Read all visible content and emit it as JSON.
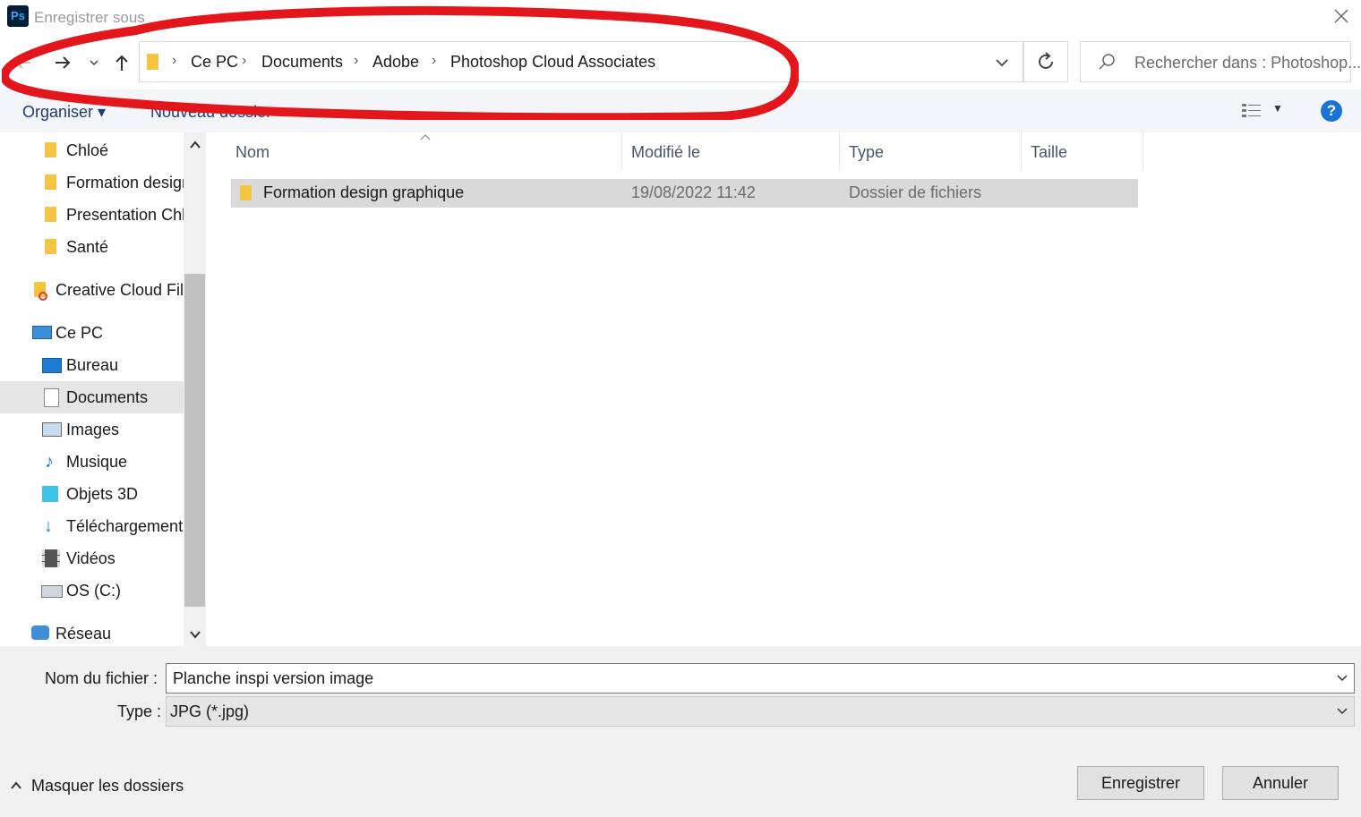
{
  "window": {
    "title": "Enregistrer sous",
    "app_icon_text": "Ps"
  },
  "address": {
    "crumbs": [
      "Ce PC",
      "Documents",
      "Adobe",
      "Photoshop Cloud Associates"
    ]
  },
  "search": {
    "placeholder": "Rechercher dans : Photoshop..."
  },
  "toolbar": {
    "organise_label": "Organiser",
    "new_folder_label": "Nouveau dossier"
  },
  "navpane": {
    "items": [
      {
        "label": "Chloé",
        "icon": "folder-icon"
      },
      {
        "label": "Formation design graphique",
        "icon": "folder-icon"
      },
      {
        "label": "Presentation Chloé",
        "icon": "folder-icon"
      },
      {
        "label": "Santé",
        "icon": "folder-icon"
      },
      {
        "label": "Creative Cloud Files",
        "icon": "creative-cloud-folder-icon"
      },
      {
        "label": "Ce PC",
        "icon": "computer-icon"
      },
      {
        "label": "Bureau",
        "icon": "desktop-icon"
      },
      {
        "label": "Documents",
        "icon": "documents-icon"
      },
      {
        "label": "Images",
        "icon": "pictures-icon"
      },
      {
        "label": "Musique",
        "icon": "music-icon"
      },
      {
        "label": "Objets 3D",
        "icon": "3d-objects-icon"
      },
      {
        "label": "Téléchargements",
        "icon": "downloads-icon"
      },
      {
        "label": "Vidéos",
        "icon": "videos-icon"
      },
      {
        "label": "OS (C:)",
        "icon": "drive-icon"
      },
      {
        "label": "Réseau",
        "icon": "network-icon"
      }
    ]
  },
  "filelist": {
    "columns": [
      "Nom",
      "Modifié le",
      "Type",
      "Taille"
    ],
    "rows": [
      {
        "name": "Formation design graphique",
        "modified": "19/08/2022 11:42",
        "type": "Dossier de fichiers",
        "size": ""
      }
    ]
  },
  "form": {
    "filename_label": "Nom du fichier :",
    "filename_value": "Planche inspi version image",
    "type_label": "Type :",
    "type_value": "JPG (*.jpg)"
  },
  "footer": {
    "hide_folders_label": "Masquer les dossiers",
    "save_label": "Enregistrer",
    "cancel_label": "Annuler"
  },
  "colors": {
    "annotation": "#e3161c",
    "help": "#1a73d9",
    "folder": "#f5c542"
  }
}
